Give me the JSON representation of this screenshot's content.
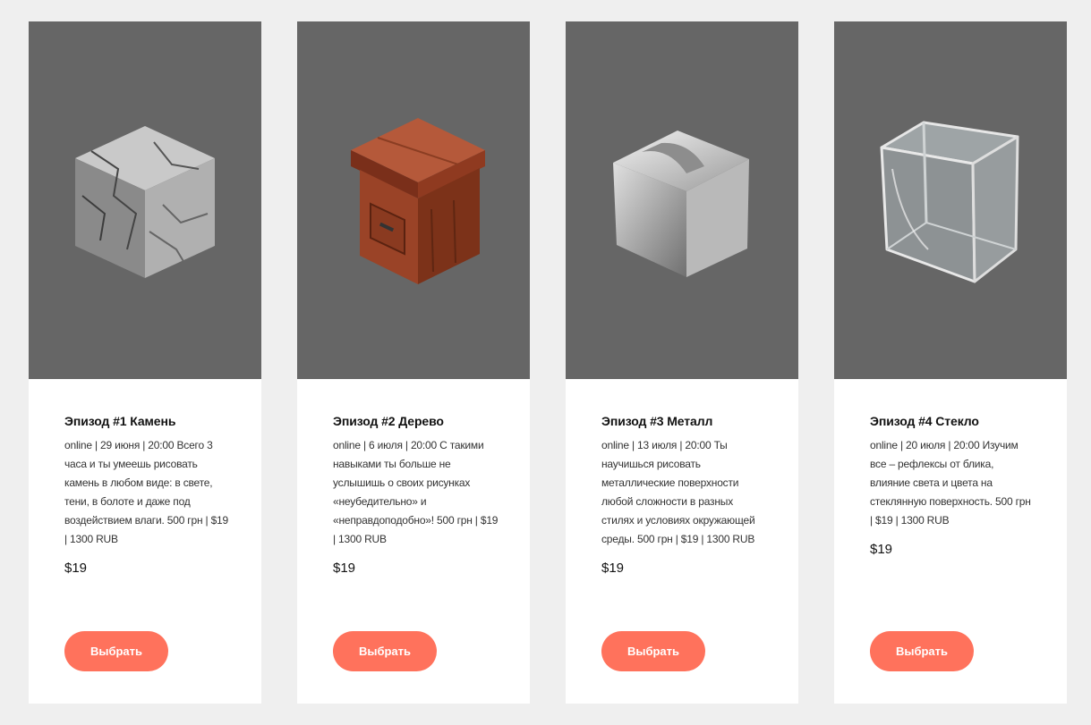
{
  "cards": [
    {
      "title": "Эпизод #1 Камень",
      "description": "online | 29 июня | 20:00 Всего 3 часа и ты умеешь рисовать камень в любом виде: в свете, тени, в болоте и даже под воздействием влаги. 500 грн | $19 | 1300 RUB",
      "price": "$19",
      "button_label": "Выбрать",
      "image_icon": "stone-cube-icon"
    },
    {
      "title": "Эпизод #2 Дерево",
      "description": "online | 6 июля | 20:00 С такими навыками ты больше не услышишь о своих рисунках «неубедительно» и «неправдоподобно»! 500 грн | $19 | 1300 RUB",
      "price": "$19",
      "button_label": "Выбрать",
      "image_icon": "wood-box-icon"
    },
    {
      "title": "Эпизод #3 Металл",
      "description": "online | 13 июля | 20:00 Ты научишься рисовать металлические поверхности любой сложности в разных стилях и условиях окружающей среды. 500 грн | $19 | 1300 RUB",
      "price": "$19",
      "button_label": "Выбрать",
      "image_icon": "metal-cube-icon"
    },
    {
      "title": "Эпизод #4 Стекло",
      "description": "online | 20 июля | 20:00 Изучим все – рефлексы от блика, влияние света и цвета на стеклянную поверхность. 500 грн | $19 | 1300 RUB",
      "price": "$19",
      "button_label": "Выбрать",
      "image_icon": "glass-cube-icon"
    }
  ],
  "colors": {
    "page_bg": "#efefef",
    "image_bg": "#666666",
    "button_bg": "#ff725c"
  }
}
